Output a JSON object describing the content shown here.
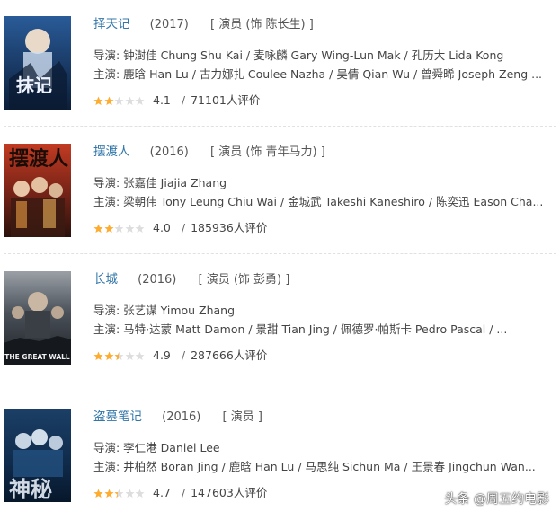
{
  "films": [
    {
      "title": "择天记",
      "year": "(2017)",
      "role": "[ 演员 (饰 陈长生) ]",
      "directors": "导演: 钟澍佳 Chung Shu Kai / 麦咏麟 Gary Wing-Lun Mak / 孔历大 Lida Kong",
      "cast": "主演: 鹿晗 Han Lu / 古力娜扎 Coulee Nazha / 吴倩 Qian Wu / 曾舜晞 Joseph Zeng ...",
      "score": "4.1",
      "slash": "/",
      "votes": "71101人评价",
      "star_fraction": 0.41,
      "poster_icon": "poster-zetianji",
      "poster_colors": [
        "#1d3b6b",
        "#d9e6f2"
      ]
    },
    {
      "title": "摆渡人",
      "year": "(2016)",
      "role": "[ 演员 (饰 青年马力) ]",
      "directors": "导演: 张嘉佳 Jiajia Zhang",
      "cast": "主演: 梁朝伟 Tony Leung Chiu Wai / 金城武 Takeshi Kaneshiro / 陈奕迅 Eason Cha...",
      "score": "4.0",
      "slash": "/",
      "votes": "185936人评价",
      "star_fraction": 0.4,
      "poster_icon": "poster-baiduren",
      "poster_colors": [
        "#b3261e",
        "#3a1a14"
      ]
    },
    {
      "title": "长城",
      "year": "(2016)",
      "role": "[ 演员 (饰 彭勇) ]",
      "directors": "导演: 张艺谋 Yimou Zhang",
      "cast": "主演: 马特·达蒙 Matt Damon / 景甜 Tian Jing / 佩德罗·帕斯卡 Pedro Pascal / ...",
      "score": "4.9",
      "slash": "/",
      "votes": "287666人评价",
      "star_fraction": 0.49,
      "poster_icon": "poster-the-great-wall",
      "poster_text": "THE GREAT WALL",
      "poster_colors": [
        "#2b3038",
        "#8e9298"
      ]
    },
    {
      "title": "盗墓笔记",
      "year": "(2016)",
      "role": "[ 演员 ]",
      "directors": "导演: 李仁港 Daniel Lee",
      "cast": "主演: 井柏然 Boran Jing / 鹿晗 Han Lu / 马思纯 Sichun Ma / 王景春 Jingchun Wan...",
      "score": "4.7",
      "slash": "/",
      "votes": "147603人评价",
      "star_fraction": 0.47,
      "poster_icon": "poster-daomubiji",
      "poster_text": "神秘",
      "poster_colors": [
        "#0f2a4a",
        "#4a86b8"
      ]
    }
  ],
  "colors": {
    "title_link": "#3377aa",
    "star_on": "#ffac2d",
    "star_off": "#dddddd"
  },
  "watermark": "头条 @周五约电影"
}
